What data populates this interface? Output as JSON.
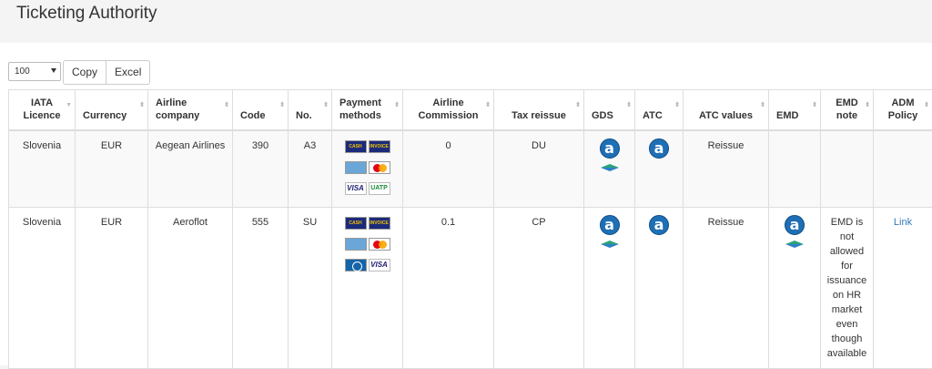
{
  "page": {
    "title": "Ticketing Authority"
  },
  "toolbar": {
    "page_size": "100",
    "copy_label": "Copy",
    "excel_label": "Excel"
  },
  "columns": [
    "IATA Licence",
    "Currency",
    "Airline company",
    "Code",
    "No.",
    "Payment methods",
    "Airline Commission",
    "Tax reissue",
    "GDS",
    "ATC",
    "ATC values",
    "EMD",
    "EMD note",
    "ADM Policy"
  ],
  "rows": [
    {
      "licence": "Slovenia",
      "currency": "EUR",
      "airline": "Aegean Airlines",
      "code": "390",
      "no": "A3",
      "payment": [
        "CASH",
        "INVOICE",
        "AMEX",
        "MASTERCARD",
        "VISA",
        "UATP"
      ],
      "commission": "0",
      "tax_reissue": "DU",
      "gds": [
        "amadeus-icon",
        "galileo-icon"
      ],
      "atc": [
        "amadeus-icon"
      ],
      "atc_values": "Reissue",
      "emd": [],
      "emd_note": "",
      "adm_policy": ""
    },
    {
      "licence": "Slovenia",
      "currency": "EUR",
      "airline": "Aeroflot",
      "code": "555",
      "no": "SU",
      "payment": [
        "CASH",
        "INVOICE",
        "AMEX",
        "MASTERCARD",
        "DINERS",
        "VISA"
      ],
      "commission": "0.1",
      "tax_reissue": "CP",
      "gds": [
        "amadeus-icon",
        "galileo-icon"
      ],
      "atc": [
        "amadeus-icon"
      ],
      "atc_values": "Reissue",
      "emd": [
        "amadeus-icon",
        "galileo-icon"
      ],
      "emd_note": "EMD is not allowed for issuance on HR market even though available",
      "adm_policy": "Link"
    }
  ],
  "icons": {
    "gds_letter": "a",
    "card_cash": "CASH",
    "card_invoice": "INVOICE",
    "card_visa": "VISA",
    "card_uatp": "UATP"
  },
  "colors": {
    "link": "#337ab7",
    "amadeus": "#1f6fb5",
    "galileo_top": "#2aa37a",
    "galileo_bottom": "#2f7fc7"
  }
}
